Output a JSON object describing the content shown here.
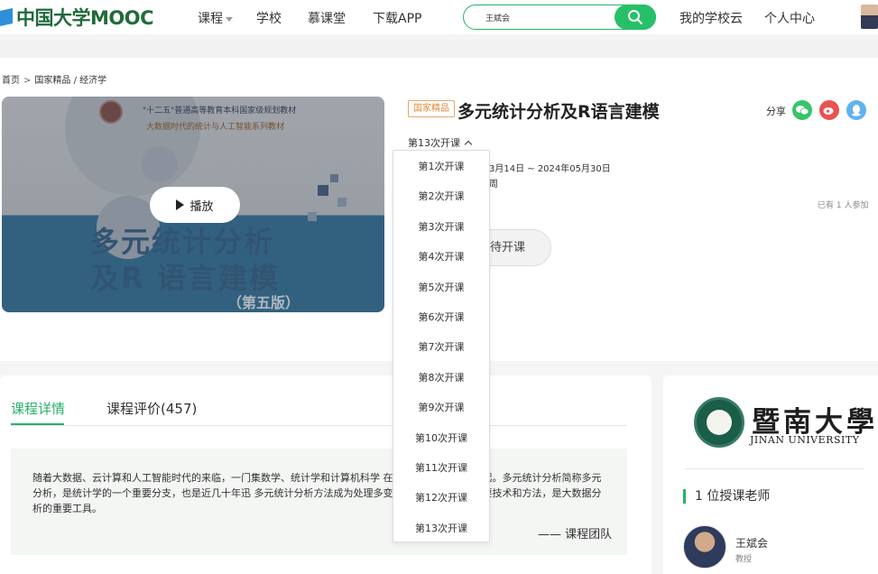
{
  "header": {
    "logo_text": "中国大学MOOC",
    "nav": [
      "课程",
      "学校",
      "慕课堂",
      "下载APP"
    ],
    "search_value": "王斌会",
    "right_links": [
      "我的学校云",
      "个人中心"
    ]
  },
  "breadcrumb": [
    "首页",
    "国家精品 / 经济学"
  ],
  "course": {
    "tag": "国家精品",
    "title": "多元统计分析及R语言建模",
    "share_label": "分享",
    "term_selected": "第13次开课",
    "dates": "3月14日 ~ 2024年05月30日",
    "hours_fragment": "周",
    "enrolled": "已有 1 人参加",
    "wait_button": "待开课",
    "play_label": "播放"
  },
  "cover": {
    "line1": "\"十二五\"普通高等教育本科国家级规划教材",
    "line2": "大数据时代的统计与人工智能系列教材",
    "title_line1": "多元统计分析",
    "title_line2": "及R 语言建模",
    "edition": "（第五版）"
  },
  "term_options": [
    "第1次开课",
    "第2次开课",
    "第3次开课",
    "第4次开课",
    "第5次开课",
    "第6次开课",
    "第7次开课",
    "第8次开课",
    "第9次开课",
    "第10次开课",
    "第11次开课",
    "第12次开课",
    "第13次开课"
  ],
  "tabs": {
    "detail": "课程详情",
    "review": "课程评价(457)"
  },
  "intro": {
    "text": "随着大数据、云计算和人工智能时代的来临，一门集数学、统计学和计算机科学 在全世界范围内迅速兴起。多元统计分析简称多元分析，是统计学的一个重要分支，也是近几十年迅 多元统计分析方法成为处理多变量数据不可缺少的重要技术和方法，是大数据分析的重要工具。",
    "signature": "—— 课程团队"
  },
  "school": {
    "name_cn": "暨南大學",
    "name_en": "JINAN UNIVERSITY",
    "teacher_count": "1 位授课老师",
    "teacher_name": "王斌会",
    "teacher_role": "教授"
  },
  "colors": {
    "accent": "#27b169",
    "tag": "#d98a3a",
    "wechat": "#37c46b",
    "weibo": "#e8524f",
    "qq": "#5fb3ef"
  }
}
